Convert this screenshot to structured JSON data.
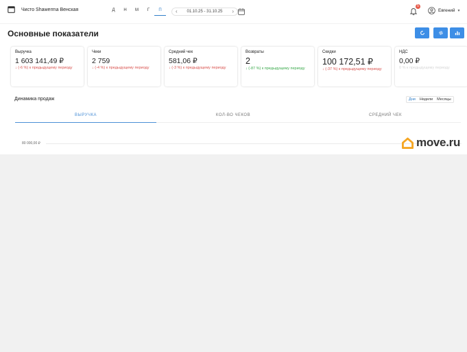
{
  "header": {
    "store_name": "Чисто Shawerma Венская",
    "periods": [
      {
        "label": "Д",
        "active": false
      },
      {
        "label": "Н",
        "active": false
      },
      {
        "label": "М",
        "active": false
      },
      {
        "label": "Г",
        "active": false
      },
      {
        "label": "П",
        "active": true
      }
    ],
    "date_range": "01.10.25 - 31.10.25",
    "prev_arrow": "‹",
    "next_arrow": "›",
    "notification_count": "5",
    "user_name": "Евгений",
    "user_caret": "▾"
  },
  "page": {
    "title": "Основные показатели",
    "action_icons": [
      "refresh-icon",
      "gear-icon",
      "bar-chart-icon"
    ]
  },
  "cards": [
    {
      "label": "Выручка",
      "value": "1 603 141,49 ₽",
      "change": "↓ (-6 %) к предыдущему периоду",
      "trend": "negative"
    },
    {
      "label": "Чеки",
      "value": "2 759",
      "change": "↓ (-4 %) к предыдущему периоду",
      "trend": "negative"
    },
    {
      "label": "Средний чек",
      "value": "581,06 ₽",
      "change": "↓ (-3 %) к предыдущему периоду",
      "trend": "negative"
    },
    {
      "label": "Возвраты",
      "value": "2",
      "change": "↓ (-87 %) к предыдущему периоду",
      "trend": "positive"
    },
    {
      "label": "Скидки",
      "value": "100 172,51 ₽",
      "change": "↓ (-37 %) к предыдущему периоду",
      "trend": "negative"
    },
    {
      "label": "НДС",
      "value": "0,00 ₽",
      "change": "0 % к предыдущему периоду",
      "trend": "neutral"
    }
  ],
  "dynamics": {
    "title": "Динамика продаж",
    "granularity": [
      {
        "label": "Дни",
        "active": true
      },
      {
        "label": "Недели",
        "active": false
      },
      {
        "label": "Месяцы",
        "active": false
      }
    ],
    "tabs": [
      {
        "label": "ВЫРУЧКА",
        "active": true
      },
      {
        "label": "КОЛ-ВО ЧЕКОВ",
        "active": false
      },
      {
        "label": "СРЕДНИЙ ЧЕК",
        "active": false
      }
    ],
    "y_tick": "80 000,00 ₽"
  },
  "watermark": {
    "text": "move.ru"
  },
  "colors": {
    "accent": "#3d8ee6",
    "negative": "#d9534f",
    "positive": "#3aa94b",
    "badge": "#e65a4a",
    "watermark_icon": "#f5a623"
  }
}
